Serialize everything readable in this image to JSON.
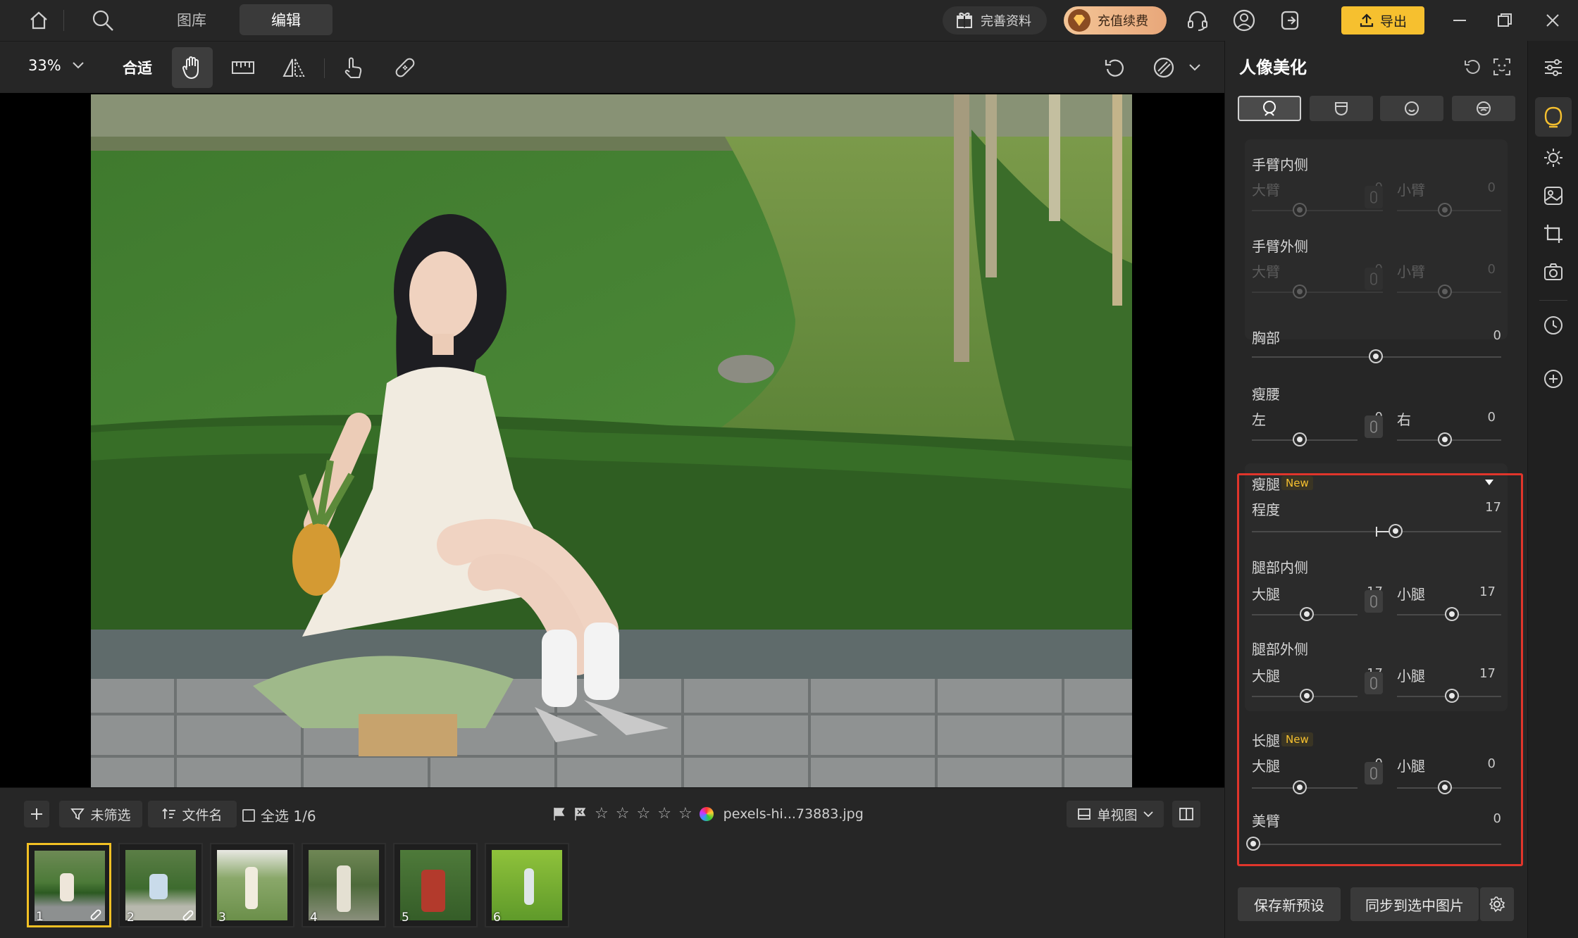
{
  "topbar": {
    "tabs": [
      {
        "label": "图库",
        "active": false
      },
      {
        "label": "编辑",
        "active": true
      }
    ],
    "complete_profile": "完善资料",
    "recharge": "充值续费",
    "export": "导出"
  },
  "toolbar": {
    "zoom": "33%",
    "fit": "合适"
  },
  "filmbar": {
    "filter": "未筛选",
    "sort": "文件名",
    "select_all": "全选 1/6",
    "filename": "pexels-hi...73883.jpg",
    "view": "单视图",
    "thumbnails": [
      {
        "num": "1",
        "edited": true,
        "selected": true
      },
      {
        "num": "2",
        "edited": true,
        "selected": false
      },
      {
        "num": "3",
        "edited": false,
        "selected": false
      },
      {
        "num": "4",
        "edited": false,
        "selected": false
      },
      {
        "num": "5",
        "edited": false,
        "selected": false
      },
      {
        "num": "6",
        "edited": false,
        "selected": false
      }
    ]
  },
  "panel": {
    "title": "人像美化",
    "arm_inner": {
      "title": "手臂内侧",
      "left_label": "大臂",
      "left_value": "0",
      "right_label": "小臂",
      "right_value": "0"
    },
    "arm_outer": {
      "title": "手臂外侧",
      "left_label": "大臂",
      "left_value": "0",
      "right_label": "小臂",
      "right_value": "0"
    },
    "chest": {
      "title": "胸部",
      "value": "0"
    },
    "waist": {
      "title": "瘦腰",
      "left_label": "左",
      "left_value": "0",
      "right_label": "右",
      "right_value": "0"
    },
    "slim_legs": {
      "title": "瘦腿",
      "badge": "New",
      "degree_label": "程度",
      "degree_value": "17"
    },
    "leg_inner": {
      "title": "腿部内侧",
      "left_label": "大腿",
      "left_value": "17",
      "right_label": "小腿",
      "right_value": "17"
    },
    "leg_outer": {
      "title": "腿部外侧",
      "left_label": "大腿",
      "left_value": "17",
      "right_label": "小腿",
      "right_value": "17"
    },
    "long_legs": {
      "title": "长腿",
      "badge": "New",
      "left_label": "大腿",
      "left_value": "0",
      "right_label": "小腿",
      "right_value": "0"
    },
    "beauty_arm": {
      "title": "美臂",
      "value": "0"
    },
    "save_preset": "保存新预设",
    "sync": "同步到选中图片"
  },
  "colors": {
    "accent": "#f6c02f",
    "highlight": "#e0352b"
  }
}
